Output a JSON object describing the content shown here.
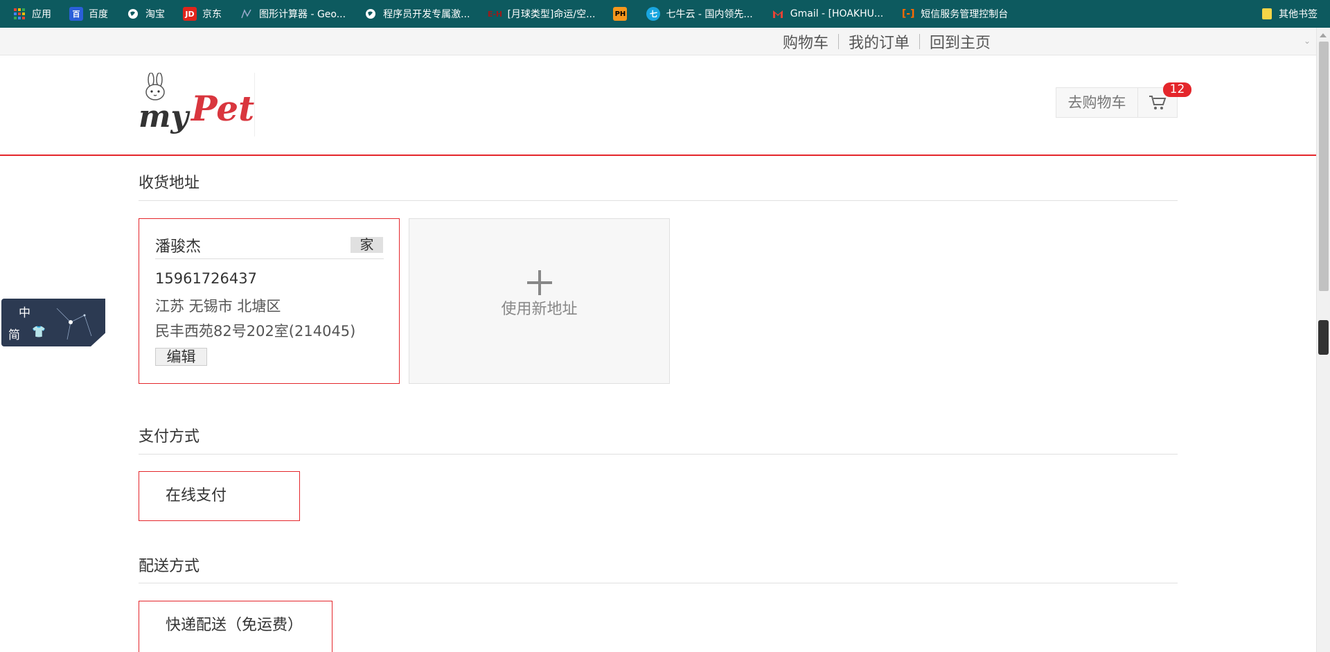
{
  "bookmarks": {
    "items": [
      {
        "label": "应用",
        "icon": "apps-grid-icon"
      },
      {
        "label": "百度",
        "icon": "baidu-icon"
      },
      {
        "label": "淘宝",
        "icon": "globe-icon"
      },
      {
        "label": "京东",
        "icon": "jd-icon"
      },
      {
        "label": "图形计算器 - Geo...",
        "icon": "geogebra-icon"
      },
      {
        "label": "程序员开发专属激...",
        "icon": "globe-icon"
      },
      {
        "label": "[月球类型]命运/空...",
        "icon": "eh-icon"
      },
      {
        "label": "",
        "icon": "ph-icon"
      },
      {
        "label": "七牛云 - 国内领先...",
        "icon": "qiniu-icon"
      },
      {
        "label": "Gmail - [HOAKHU...",
        "icon": "gmail-icon"
      },
      {
        "label": "短信服务管理控制台",
        "icon": "aliyun-icon"
      }
    ],
    "other": "其他书签"
  },
  "topnav": {
    "cart": "购物车",
    "orders": "我的订单",
    "home": "回到主页"
  },
  "header": {
    "logo_my": "my",
    "logo_pet": "Pet",
    "cart_label": "去购物车",
    "cart_count": "12"
  },
  "address": {
    "title": "收货地址",
    "name": "潘骏杰",
    "tag": "家",
    "phone": "15961726437",
    "region": "江苏 无锡市 北塘区",
    "street": "民丰西苑82号202室(214045)",
    "edit": "编辑",
    "new_address": "使用新地址"
  },
  "payment": {
    "title": "支付方式",
    "option": "在线支付"
  },
  "delivery": {
    "title": "配送方式",
    "option": "快递配送（免运费）"
  },
  "widget": {
    "char1": "中",
    "char2": "简"
  },
  "colors": {
    "accent": "#e4262b",
    "bookmark_bar": "#0d5a5f"
  }
}
